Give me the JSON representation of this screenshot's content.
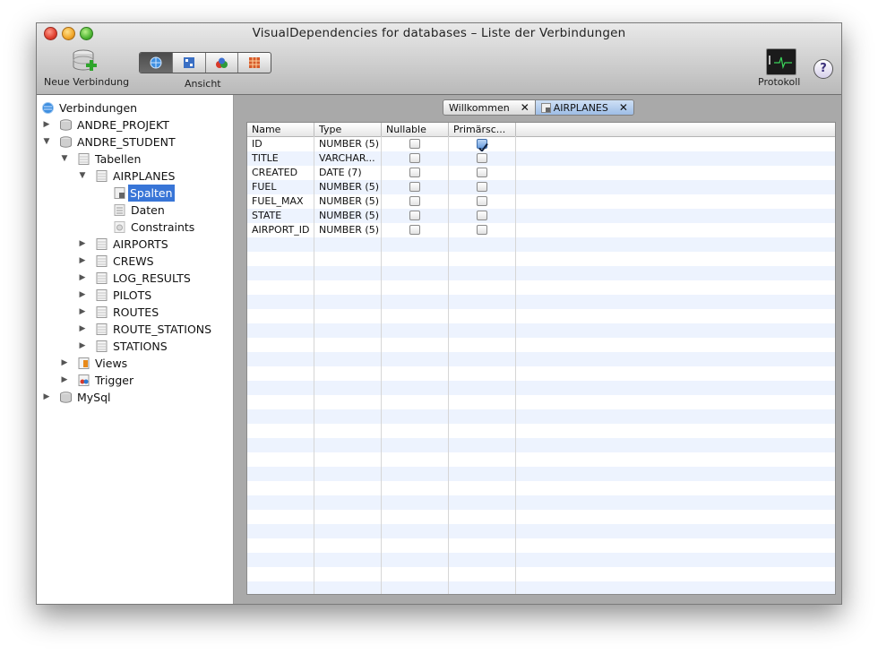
{
  "window": {
    "title": "VisualDependencies for databases – Liste der Verbindungen"
  },
  "toolbar": {
    "new_connection_label": "Neue Verbindung",
    "view_label": "Ansicht",
    "log_label": "Protokoll",
    "help_label": "?"
  },
  "tree": {
    "root": "Verbindungen",
    "items": [
      {
        "label": "ANDRE_PROJEKT"
      },
      {
        "label": "ANDRE_STUDENT"
      },
      {
        "label": "Tabellen"
      },
      {
        "label": "AIRPLANES"
      },
      {
        "label": "Spalten"
      },
      {
        "label": "Daten"
      },
      {
        "label": "Constraints"
      },
      {
        "label": "AIRPORTS"
      },
      {
        "label": "CREWS"
      },
      {
        "label": "LOG_RESULTS"
      },
      {
        "label": "PILOTS"
      },
      {
        "label": "ROUTES"
      },
      {
        "label": "ROUTE_STATIONS"
      },
      {
        "label": "STATIONS"
      },
      {
        "label": "Views"
      },
      {
        "label": "Trigger"
      },
      {
        "label": "MySql"
      }
    ]
  },
  "tabs": [
    {
      "label": "Willkommen",
      "close": "✕"
    },
    {
      "label": "AIRPLANES",
      "close": "✕"
    }
  ],
  "table": {
    "columns": [
      "Name",
      "Type",
      "Nullable",
      "Primärsc..."
    ],
    "rows": [
      {
        "name": "ID",
        "type": "NUMBER (5)",
        "nullable": false,
        "primary": true
      },
      {
        "name": "TITLE",
        "type": "VARCHAR...",
        "nullable": false,
        "primary": false
      },
      {
        "name": "CREATED",
        "type": "DATE (7)",
        "nullable": false,
        "primary": false
      },
      {
        "name": "FUEL",
        "type": "NUMBER (5)",
        "nullable": false,
        "primary": false
      },
      {
        "name": "FUEL_MAX",
        "type": "NUMBER (5)",
        "nullable": false,
        "primary": false
      },
      {
        "name": "STATE",
        "type": "NUMBER (5)",
        "nullable": false,
        "primary": false
      },
      {
        "name": "AIRPORT_ID",
        "type": "NUMBER (5)",
        "nullable": false,
        "primary": false
      }
    ]
  },
  "colors": {
    "selection": "#3875d7",
    "row_alt": "#edf3fe"
  }
}
